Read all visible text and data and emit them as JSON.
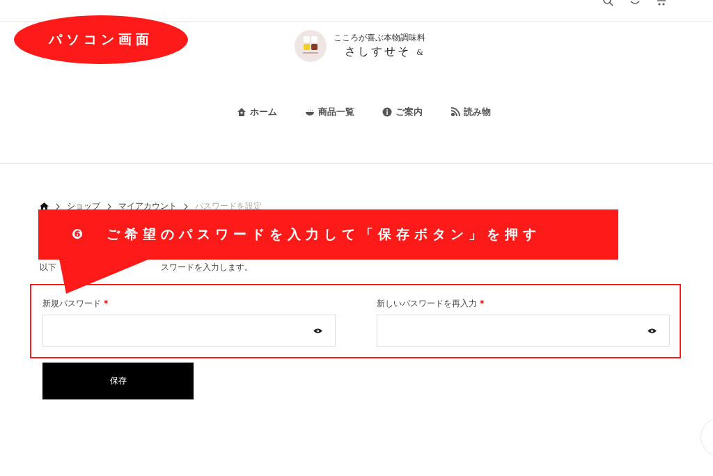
{
  "callout_label": "パソコン画面",
  "logo": {
    "tagline": "こころが喜ぶ本物調味料",
    "name": "さしすせそ",
    "suffix": "&"
  },
  "nav": [
    {
      "label": "ホーム",
      "kind": "home"
    },
    {
      "label": "商品一覧",
      "kind": "bowl"
    },
    {
      "label": "ご案内",
      "kind": "info"
    },
    {
      "label": "読み物",
      "kind": "feed"
    }
  ],
  "breadcrumb": {
    "items": [
      "ショップ",
      "マイアカウント"
    ],
    "current": "パスワードを設定"
  },
  "instruction_banner": {
    "number": "❻",
    "text": "ご希望のパスワードを入力して「保存ボタン」を押す"
  },
  "intro_fragments": [
    "以下",
    "スワードを入力します。"
  ],
  "fields": [
    {
      "label": "新規パスワード",
      "required": true,
      "required_mark": "*"
    },
    {
      "label": "新しいパスワードを再入力",
      "required": true,
      "required_mark": "*"
    }
  ],
  "save_button": "保存"
}
